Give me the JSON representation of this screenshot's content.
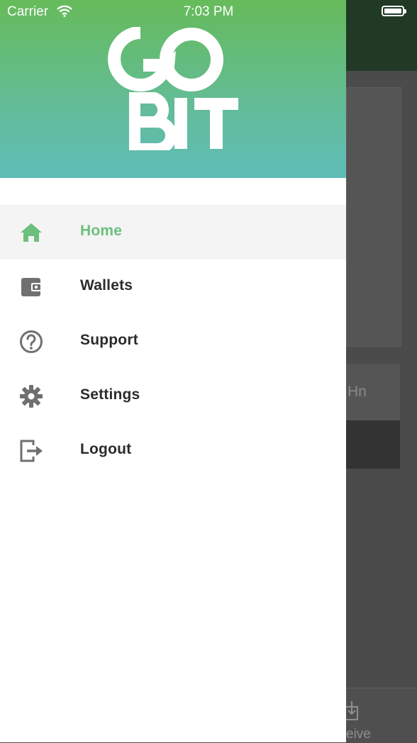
{
  "status_bar": {
    "carrier": "Carrier",
    "time": "7:03 PM"
  },
  "drawer": {
    "logo_alt": "GO BIT",
    "brand_gradient": [
      "#66bb5a",
      "#5fbdb8"
    ],
    "accent_color": "#6cbf7d",
    "menu": [
      {
        "label": "Home",
        "icon": "home-icon",
        "active": true
      },
      {
        "label": "Wallets",
        "icon": "wallet-icon",
        "active": false
      },
      {
        "label": "Support",
        "icon": "help-circle-icon",
        "active": false
      },
      {
        "label": "Settings",
        "icon": "gear-icon",
        "active": false
      },
      {
        "label": "Logout",
        "icon": "logout-icon",
        "active": false
      }
    ]
  },
  "background_screen": {
    "card_text_fragment": "Hn",
    "tab_label_fragment": "eive"
  }
}
